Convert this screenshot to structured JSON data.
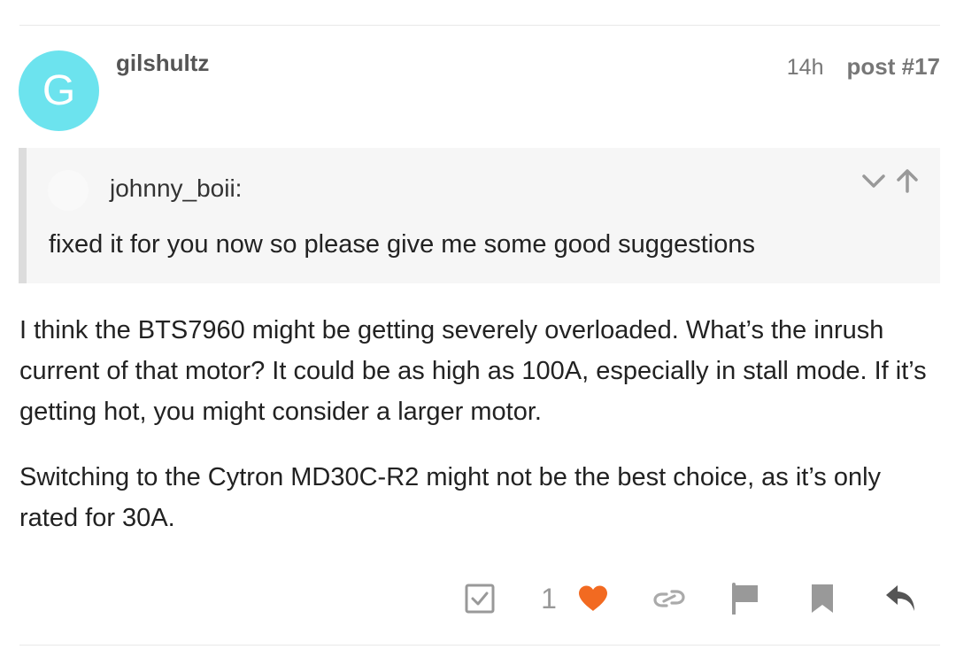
{
  "post": {
    "avatar_letter": "G",
    "avatar_color": "#6ce3ee",
    "username": "gilshultz",
    "time": "14h",
    "post_number": "post #17"
  },
  "quote": {
    "author": "johnny_boii:",
    "text": "fixed it for you now so please give me some good suggestions"
  },
  "body": {
    "paragraphs": [
      "I think the BTS7960 might be getting severely overloaded. What’s the inrush current of that motor? It could be as high as 100A, especially in stall mode. If it’s getting hot, you might consider a larger motor.",
      "Switching to the Cytron MD30C-R2 might not be the best choice, as it’s only rated for 30A."
    ]
  },
  "actions": {
    "like_count": "1",
    "like_color": "#f26a21",
    "icons": [
      "solution-checkbox-icon",
      "heart-icon",
      "link-icon",
      "flag-icon",
      "bookmark-icon",
      "reply-icon"
    ]
  }
}
